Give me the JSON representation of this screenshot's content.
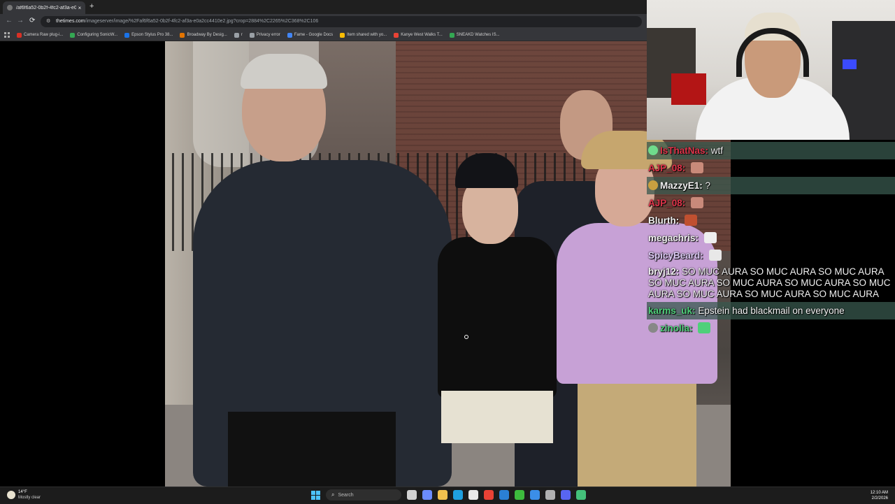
{
  "browser": {
    "tab_title": "/af6f6a52-0b2f-4fc2-af3a-e0a2...",
    "tab_close": "×",
    "new_tab": "+",
    "url_domain": "thetimes.com",
    "url_path": "/imageserver/image/%2Faf6f6a52-0b2f-4fc2-af3a-e0a2cc4410e2.jpg?crop=2884%2C2265%2C368%2C106",
    "back": "←",
    "forward": "→",
    "reload": "⟳",
    "bookmarks": [
      {
        "label": "Camera Raw plug-i...",
        "color": "#d93025"
      },
      {
        "label": "Configuring SonicW...",
        "color": "#34a853"
      },
      {
        "label": "Epson Stylus Pro 38...",
        "color": "#1a73e8"
      },
      {
        "label": "Broadway By Desig...",
        "color": "#e37400"
      },
      {
        "label": "r",
        "color": "#9aa0a6"
      },
      {
        "label": "Privacy error",
        "color": "#9aa0a6"
      },
      {
        "label": "Fame - Google Docs",
        "color": "#4285f4"
      },
      {
        "label": "Item shared with yo...",
        "color": "#fbbc04"
      },
      {
        "label": "Kanye West Walks T...",
        "color": "#ea4335"
      },
      {
        "label": "SNEAKD Watches IS...",
        "color": "#34a853"
      }
    ]
  },
  "chat": {
    "messages": [
      {
        "user": "IsThatNas",
        "user_color": "#e0344a",
        "sep": ":",
        "text": "wtf",
        "highlight": true,
        "badge_color": "#6fdc8c",
        "emote_color": ""
      },
      {
        "user": "AJP_08",
        "user_color": "#e0344a",
        "sep": ":",
        "text": "",
        "highlight": false,
        "badge_color": "",
        "emote_color": "#c98a7a"
      },
      {
        "user": "MazzyE1",
        "user_color": "#f0f0f0",
        "sep": ":",
        "text": "?",
        "highlight": true,
        "badge_color": "#c8a040",
        "emote_color": ""
      },
      {
        "user": "AJP_08",
        "user_color": "#e0344a",
        "sep": ":",
        "text": "",
        "highlight": false,
        "badge_color": "",
        "emote_color": "#c98a7a"
      },
      {
        "user": "Blurth",
        "user_color": "#f0f0f0",
        "sep": ":",
        "text": "",
        "highlight": false,
        "badge_color": "",
        "emote_color": "#c05030"
      },
      {
        "user": "megachris",
        "user_color": "#f0f0f0",
        "sep": ":",
        "text": "",
        "highlight": false,
        "badge_color": "",
        "emote_color": "#eeeeee"
      },
      {
        "user": "SpicyBeard",
        "user_color": "#d8c8f0",
        "sep": ":",
        "text": "",
        "highlight": false,
        "badge_color": "",
        "emote_color": "#e8e8e8"
      },
      {
        "user": "bryj12",
        "user_color": "#f0f0f0",
        "sep": ":",
        "text": "SO MUC AURA SO MUC AURA SO MUC AURA SO MUC AURA SO MUC AURA SO MUC AURA SO MUC AURA SO MUC AURA SO MUC AURA SO MUC AURA",
        "highlight": false,
        "badge_color": "",
        "emote_color": ""
      },
      {
        "user": "karms_uk",
        "user_color": "#4fd07a",
        "sep": ":",
        "text": "Epstein had blackmail on everyone",
        "highlight": true,
        "badge_color": "",
        "emote_color": ""
      },
      {
        "user": "zinolia",
        "user_color": "#4fd07a",
        "sep": ":",
        "text": "",
        "highlight": false,
        "badge_color": "#888888",
        "emote_color": "#4fd07a"
      }
    ]
  },
  "taskbar": {
    "temperature": "14°F",
    "condition": "Mostly clear",
    "search_placeholder": "Search",
    "time": "12:10 AM",
    "date": "2/2/2026",
    "pinned": [
      {
        "name": "task-view-icon",
        "color": "#d0d0d0"
      },
      {
        "name": "copilot-icon",
        "color": "#6b8cff"
      },
      {
        "name": "file-explorer-icon",
        "color": "#f2c14e"
      },
      {
        "name": "edge-icon",
        "color": "#1fa0e0"
      },
      {
        "name": "store-icon",
        "color": "#e8e8e8"
      },
      {
        "name": "chrome-icon",
        "color": "#e94235"
      },
      {
        "name": "vscode-icon",
        "color": "#2a7fd4"
      },
      {
        "name": "xbox-icon",
        "color": "#3dbb3d"
      },
      {
        "name": "photos-icon",
        "color": "#3b8ee8"
      },
      {
        "name": "settings-icon",
        "color": "#b0b0b0"
      },
      {
        "name": "discord-icon",
        "color": "#5865f2"
      },
      {
        "name": "obs-icon",
        "color": "#44c07a"
      }
    ]
  },
  "colors": {
    "chat_highlight": "#38584e",
    "taskbar_bg": "#1c1c1c",
    "browser_toolbar": "#35363a"
  }
}
